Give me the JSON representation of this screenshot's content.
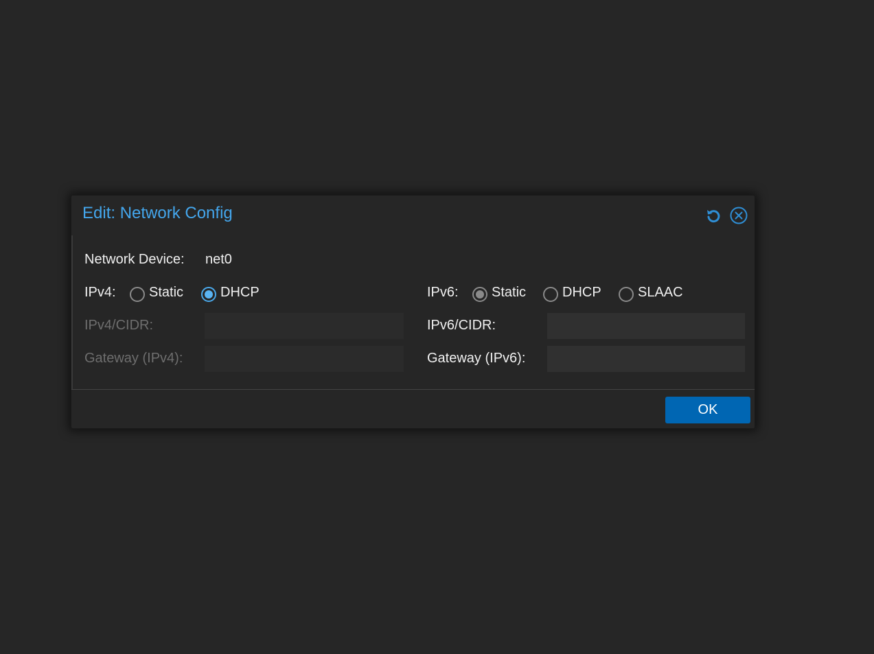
{
  "dialog": {
    "title": "Edit: Network Config",
    "tools": {
      "reset_icon": "undo-icon",
      "close_icon": "close-circle-icon"
    },
    "accent_color": "#44a6ec",
    "device": {
      "label": "Network Device:",
      "value": "net0"
    },
    "ipv4": {
      "label": "IPv4:",
      "options": [
        {
          "label": "Static",
          "checked": false
        },
        {
          "label": "DHCP",
          "checked": true
        }
      ],
      "cidr_label": "IPv4/CIDR:",
      "cidr_value": "",
      "gateway_label": "Gateway (IPv4):",
      "gateway_value": "",
      "fields_disabled": true
    },
    "ipv6": {
      "label": "IPv6:",
      "options": [
        {
          "label": "Static",
          "checked": true
        },
        {
          "label": "DHCP",
          "checked": false
        },
        {
          "label": "SLAAC",
          "checked": false
        }
      ],
      "cidr_label": "IPv6/CIDR:",
      "cidr_value": "",
      "gateway_label": "Gateway (IPv6):",
      "gateway_value": ""
    },
    "ok_label": "OK",
    "ok_color": "#0066b3"
  }
}
